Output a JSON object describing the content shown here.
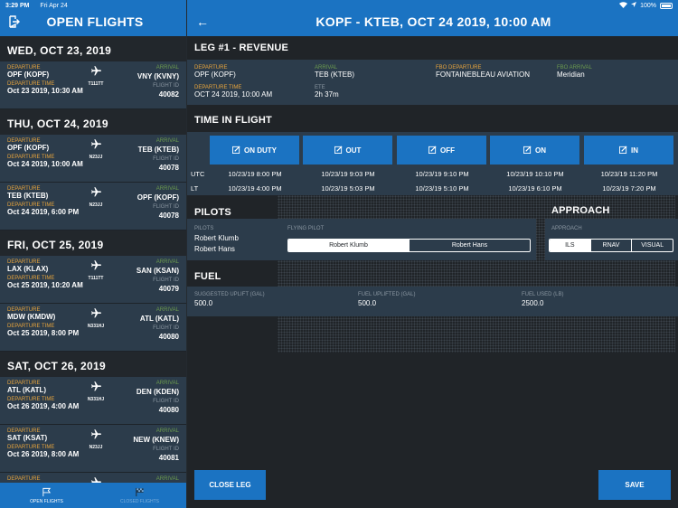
{
  "status": {
    "time": "3:29 PM",
    "date": "Fri Apr 24",
    "battery": "100%"
  },
  "left": {
    "title": "OPEN FLIGHTS",
    "days": [
      {
        "label": "WED, OCT 23, 2019",
        "flights": [
          {
            "departure": "OPF (KOPF)",
            "arrival": "VNY (KVNY)",
            "tail": "T111TT",
            "departure_time": "Oct 23 2019, 10:30 AM",
            "flight_id": "40082"
          }
        ]
      },
      {
        "label": "THU, OCT 24, 2019",
        "flights": [
          {
            "departure": "OPF (KOPF)",
            "arrival": "TEB (KTEB)",
            "tail": "N23JJ",
            "departure_time": "Oct 24 2019, 10:00 AM",
            "flight_id": "40078"
          },
          {
            "departure": "TEB (KTEB)",
            "arrival": "OPF (KOPF)",
            "tail": "N23JJ",
            "departure_time": "Oct 24 2019, 6:00 PM",
            "flight_id": "40078"
          }
        ]
      },
      {
        "label": "FRI, OCT 25, 2019",
        "flights": [
          {
            "departure": "LAX (KLAX)",
            "arrival": "SAN (KSAN)",
            "tail": "T111TT",
            "departure_time": "Oct 25 2019, 10:20 AM",
            "flight_id": "40079"
          },
          {
            "departure": "MDW (KMDW)",
            "arrival": "ATL (KATL)",
            "tail": "N331HJ",
            "departure_time": "Oct 25 2019, 8:00 PM",
            "flight_id": "40080"
          }
        ]
      },
      {
        "label": "SAT, OCT 26, 2019",
        "flights": [
          {
            "departure": "ATL (KATL)",
            "arrival": "DEN (KDEN)",
            "tail": "N331HJ",
            "departure_time": "Oct 26 2019, 4:00 AM",
            "flight_id": "40080"
          },
          {
            "departure": "SAT (KSAT)",
            "arrival": "NEW (KNEW)",
            "tail": "N23JJ",
            "departure_time": "Oct 26 2019, 8:00 AM",
            "flight_id": "40081"
          }
        ]
      }
    ],
    "labels": {
      "departure": "DEPARTURE",
      "arrival": "ARRIVAL",
      "departure_time": "DEPARTURE TIME",
      "flight_id": "FLIGHT ID"
    },
    "partial_row": {
      "departure": "DEPARTURE",
      "arrival": "ARRIVAL"
    },
    "tabs": {
      "open": "OPEN FLIGHTS",
      "closed": "CLOSED FLIGHTS"
    }
  },
  "right": {
    "title": "KOPF - KTEB, OCT 24 2019, 10:00 AM",
    "leg": {
      "heading": "LEG #1 - REVENUE",
      "departure_label": "DEPARTURE",
      "departure": "OPF (KOPF)",
      "arrival_label": "ARRIVAL",
      "arrival": "TEB (KTEB)",
      "fbo_departure_label": "FBO DEPARTURE",
      "fbo_departure": "FONTAINEBLEAU AVIATION",
      "fbo_arrival_label": "FBO ARRIVAL",
      "fbo_arrival": "Meridian",
      "departure_time_label": "DEPARTURE TIME",
      "departure_time": "OCT 24 2019, 10:00 AM",
      "ete_label": "ETE",
      "ete": "2h 37m"
    },
    "time_in_flight": {
      "heading": "TIME IN FLIGHT",
      "buttons": [
        "ON DUTY",
        "OUT",
        "OFF",
        "ON",
        "IN"
      ],
      "utc_label": "UTC",
      "lt_label": "LT",
      "utc": [
        "10/23/19 8:00 PM",
        "10/23/19 9:03 PM",
        "10/23/19 9:10 PM",
        "10/23/19 10:10 PM",
        "10/23/19 11:20 PM"
      ],
      "lt": [
        "10/23/19 4:00 PM",
        "10/23/19 5:03 PM",
        "10/23/19 5:10 PM",
        "10/23/19 6:10 PM",
        "10/23/19 7:20 PM"
      ]
    },
    "pilots": {
      "heading": "PILOTS",
      "pilots_label": "PILOTS",
      "names": [
        "Robert Klumb",
        "Robert Hans"
      ],
      "flying_pilot_label": "FLYING PILOT",
      "options": [
        "Robert Klumb",
        "Robert Hans"
      ],
      "selected": "Robert Klumb"
    },
    "approach": {
      "heading": "APPROACH",
      "label": "APPROACH",
      "options": [
        "ILS",
        "RNAV",
        "VISUAL"
      ],
      "selected": "ILS"
    },
    "fuel": {
      "heading": "FUEL",
      "suggested_label": "SUGGESTED UPLIFT (GAL)",
      "suggested": "500.0",
      "uplifted_label": "FUEL UPLIFTED (GAL)",
      "uplifted": "500.0",
      "used_label": "FUEL USED (LB)",
      "used": "2500.0"
    },
    "close_leg": "CLOSE LEG",
    "save": "SAVE"
  },
  "colors": {
    "accent": "#1b73c2",
    "card": "#2c3c4b",
    "orange": "#e8a53c",
    "green": "#6b9a4e"
  }
}
